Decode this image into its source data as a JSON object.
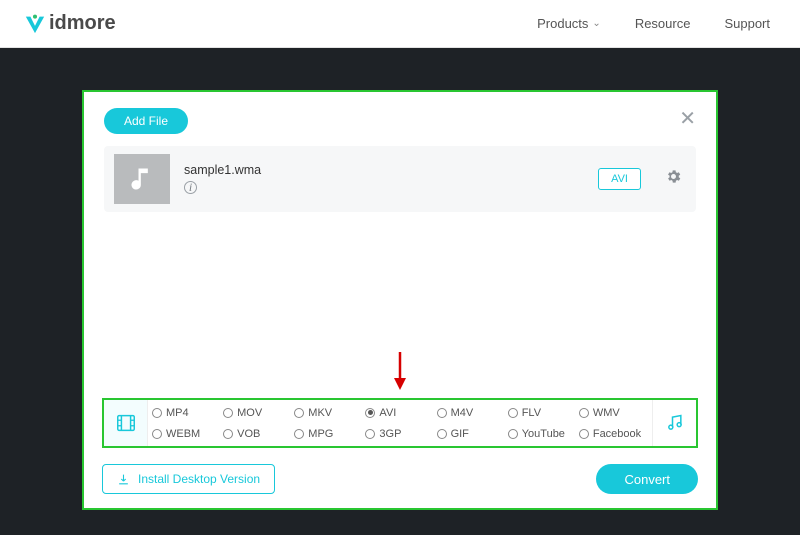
{
  "brand": "idmore",
  "nav": {
    "products": "Products",
    "resource": "Resource",
    "support": "Support"
  },
  "panel": {
    "add_file": "Add File",
    "file": {
      "name": "sample1.wma",
      "format_button": "AVI"
    },
    "install_label": "Install Desktop Version",
    "convert_label": "Convert"
  },
  "formats": {
    "row1": [
      "MP4",
      "MOV",
      "MKV",
      "AVI",
      "M4V",
      "FLV",
      "WMV"
    ],
    "row2": [
      "WEBM",
      "VOB",
      "MPG",
      "3GP",
      "GIF",
      "YouTube",
      "Facebook"
    ],
    "selected": "AVI"
  }
}
